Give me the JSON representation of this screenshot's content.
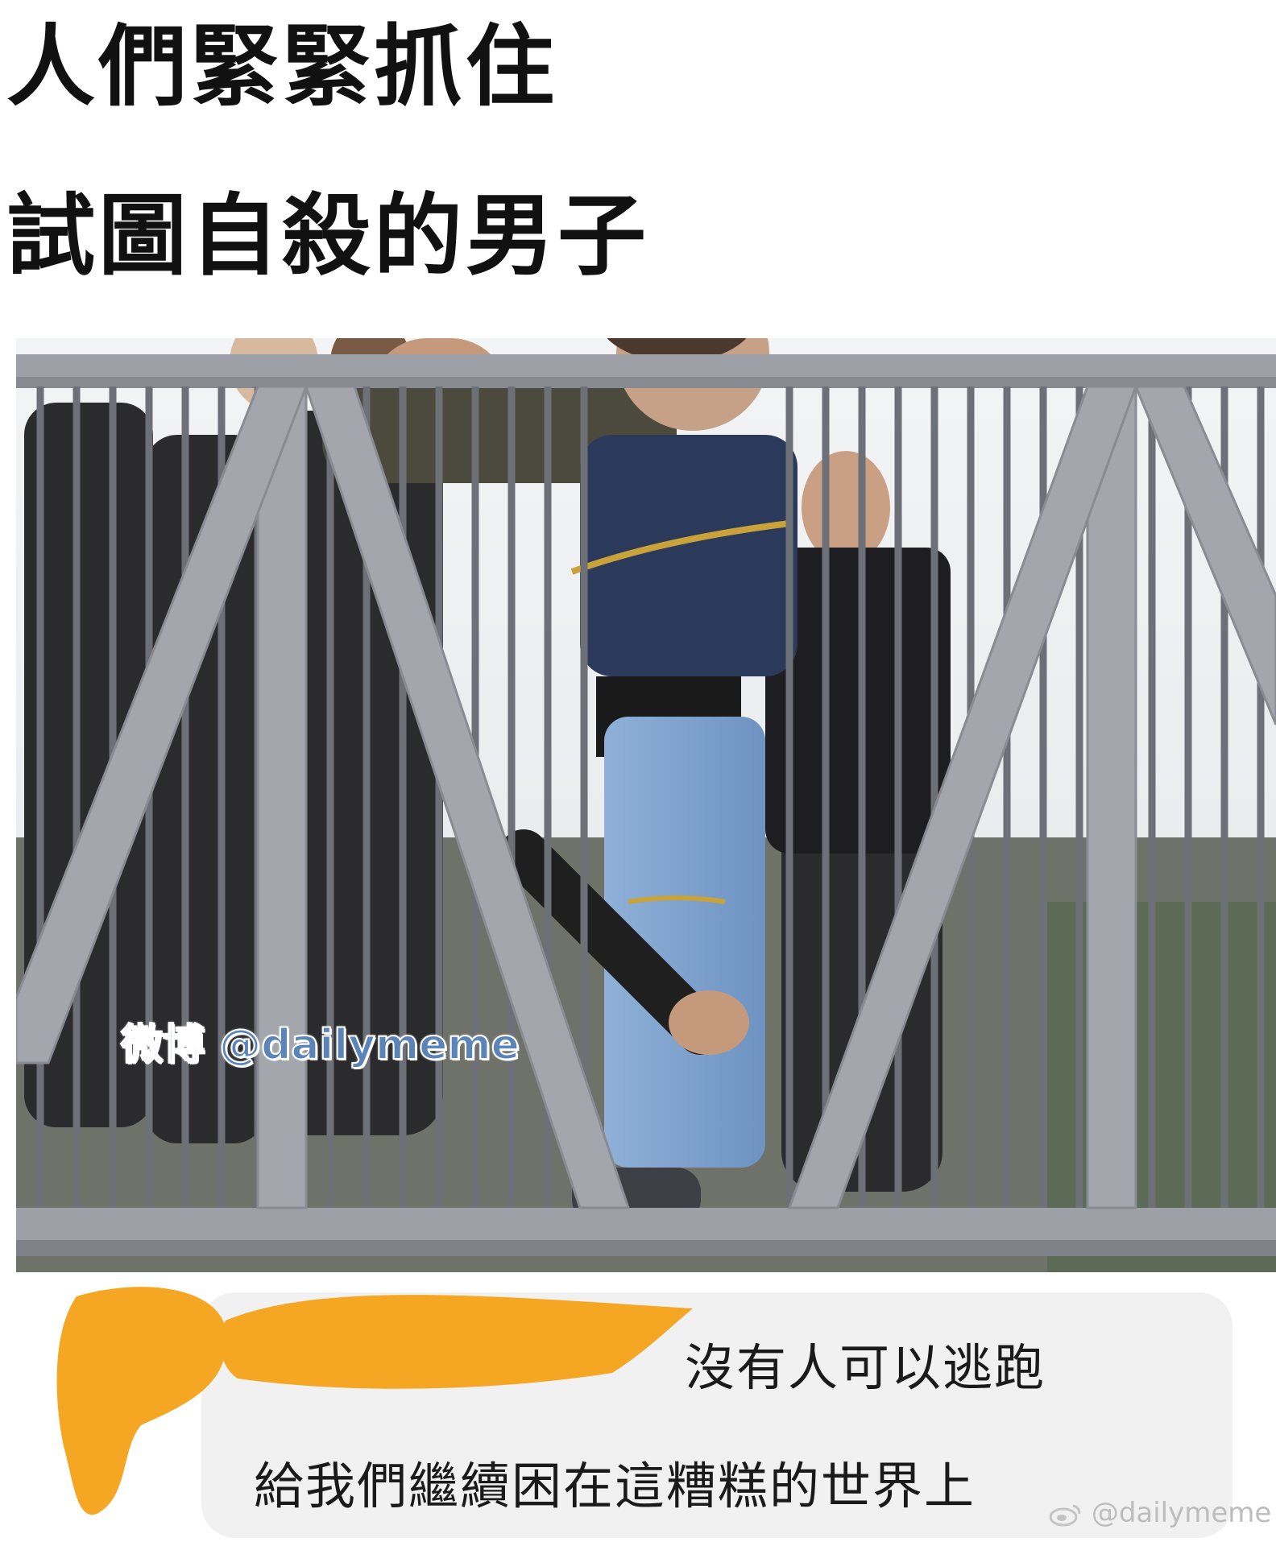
{
  "caption": {
    "line1": "人們緊緊抓住",
    "line2": "試圖自殺的男子"
  },
  "photo": {
    "subject": "footbridge-rescue-photo"
  },
  "comment": {
    "line1": "沒有人可以逃跑",
    "line2": "給我們繼續困在這糟糕的世界上",
    "redaction_color": "#f5a623"
  },
  "watermark": {
    "center": "微博 @dailymeme",
    "corner": "@dailymeme",
    "corner_icon": "weibo-icon"
  }
}
